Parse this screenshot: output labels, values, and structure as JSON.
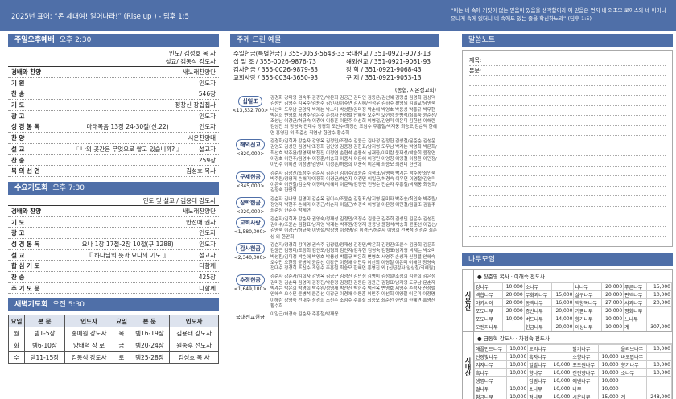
{
  "header": {
    "slogan": "2025년 표어: “온 세대여! 일어나라!” (Rise up ) - 딤후 1:5",
    "verse": "“이는 네 속에 거짓이 없는 믿음이 있음을 생각함이라 이 믿음은 먼저 네 외조모 로이스와 네 어머니 유니게 속에 있더니 네 속에도 있는 줄을 확신하노라” (딤후 1:5)"
  },
  "sunday": {
    "title": "주일오후예배",
    "time": "오후 2:30",
    "lead1": "인도/ 김성호 목 사",
    "lead2": "설교/ 김동석 강도사",
    "rows": [
      {
        "k": "경배와 찬양",
        "c": "",
        "r": "새노래찬양단"
      },
      {
        "k": "기 원",
        "c": "",
        "r": "인도자"
      },
      {
        "k": "찬 송",
        "c": "",
        "r": "546장"
      },
      {
        "k": "기 도",
        "c": "",
        "r": "정창신 장립집사"
      },
      {
        "k": "광 고",
        "c": "",
        "r": "인도자"
      },
      {
        "k": "성 경 봉 독",
        "c": "마태복음 13장 24-30절(신.22)",
        "r": "인도자"
      },
      {
        "k": "찬 양",
        "c": "",
        "r": "시온찬양대"
      },
      {
        "k": "설 교",
        "c": "『 나의 곳간은 무엇으로 쌓고 있습니까? 』",
        "r": "설교자"
      },
      {
        "k": "찬 송",
        "c": "",
        "r": "259장"
      },
      {
        "k": "복 의 선 언",
        "c": "",
        "r": "김성호 목사"
      }
    ]
  },
  "wednesday": {
    "title": "수요기도회",
    "time": "오후 7:30",
    "lead": "인도 및 설교 / 김용태 강도사",
    "rows": [
      {
        "k": "경배와 찬양",
        "c": "",
        "r": "새노래찬양단"
      },
      {
        "k": "기 도",
        "c": "",
        "r": "안선애 권사"
      },
      {
        "k": "광 고",
        "c": "",
        "r": "인도자"
      },
      {
        "k": "성 경 봉 독",
        "c": "요나 1장 17절-2장 10절(구.1288)",
        "r": "인도자"
      },
      {
        "k": "설 교",
        "c": "『 하나님의 뜻과 요나의 기도 』",
        "r": "설교자"
      },
      {
        "k": "합 심 기 도",
        "c": "",
        "r": "다함께"
      },
      {
        "k": "찬 송",
        "c": "",
        "r": "425장"
      },
      {
        "k": "주 기 도 문",
        "c": "",
        "r": "다함께"
      }
    ]
  },
  "dawn": {
    "title": "새벽기도회",
    "time": "오전 5:30",
    "headers": [
      "요일",
      "본 문",
      "인도자",
      "요일",
      "본 문",
      "인도자"
    ],
    "rows": [
      [
        "월",
        "템1-5장",
        "송예원 강도사",
        "목",
        "템16-19장",
        "김용태 강도사"
      ],
      [
        "화",
        "템6-10장",
        "양태혁 장 로",
        "금",
        "템20-24장",
        "원종후 전도사"
      ],
      [
        "수",
        "템11-15장",
        "김동석 강도사",
        "토",
        "템25-28장",
        "김성호 목 사"
      ]
    ]
  },
  "offering": {
    "title": "주께 드린 예물",
    "accounts": [
      [
        "주일헌금(특별헌금) / 355-0053-5643-33",
        "국내선교 / 351-0921-9073-13"
      ],
      [
        "십 일 조 / 355-0026-9876-73",
        "해외선교 / 351-0921-9061-93"
      ],
      [
        "감사헌금 / 355-0026-9879-83",
        "장 학 / 351-0921-9068-43"
      ],
      [
        "교회사랑 / 355-0034-3650-93",
        "구 제 / 351-0921-9053-13"
      ]
    ],
    "bank_note": "(농협, 시온성교회)",
    "items": [
      {
        "label": "십일조",
        "amount": "<13,532,700>",
        "text": "강경화 강미영 권숙주 김경민/박은희 김공근 김다인 김동은/김선혜 김명섭 김명희 김상덕 김성민 김영수 김옥수/김용주 김인자/이주연 김지혜/신정우 김하수 황영임 김필교/남명숙 나선미 도우남 문양자 박계는 박소미 박성환/김미정 박순애 박영호 박용성 박홍규 박우현 박은희 변영호 서영주/김은주 손성자 신정렬 안혜숙 오수민 오현정 윤병석/최홍숙 윤준선/조성남 이강근/허규숙 이경애 이동훈 이민주 이선희 이영철/김영미 이은미 김한선 이해란 김상진 외 장영숙 전대수 정경희 조신수/최정선 조임수 주홍철/박재웅 최승모/김순덕 한혜연 홍영진 외 최준선 최연상 한만수 황수희"
      },
      {
        "label": "해외선교",
        "amount": "<820,000>",
        "text": "강경화/김희자 강순자 강영옥 김정민/조정수 김윤근 김나정 김정헌 김성철/문준순 김성운 김영모 김성민 김영식/조정희 김인영 김종정 김현표/남지영 도우남 박계는 박영희 박은희/최선호 박주완/정영재 박천진 이정연 손현석 손종식 심재한/이미란 윤재성/박승희 윤정연 이강호 이민주/김영수 이정훈/허승희 이종식 이은혜 이정민 이영칭 이영철 이정환 이민정/이민주 이혜선 이정명/김영미 이정훈/허승희 이종식 이은혜 최승모 최선미 한만희"
      },
      {
        "label": "구제헌금",
        "amount": "<345,000>",
        "text": "강순자 김광진/조정수 김순자 김순진 김이수/조윤순 김형표/남명숙 박계는 박주송/최인숙 박주원/정영재 손해미/이정하 이경근/허순자 이경민 이일근/허경숙 이우연 이영철/김영미 이은숙 이인철/김순자 이정태/박혜미 이준택/김정민 전명순 전순자 주홍철/박재웅 최영희/김정숙 한만희"
      },
      {
        "label": "장학헌금",
        "amount": "<220,000>",
        "text": "강순자 김나영 김명미 김순옥 김이수/조윤순 김형표/남지영 문미자 박주송/최인숙 박주원/정영재 박현주 손혜미 이경근/허순자 이일근/허경숙 이영철 이은정 이민철/김필조 김월주 최순상 한준수 박세현"
      },
      {
        "label": "교회사랑",
        "amount": "<1,580,000>",
        "text": "강순자/김희자 강순자 권영숙/정재성 김정민/조정수 김윤근 김주희 김성민 김은수 김성진 김이수/조윤순 김형표/남지영 박계는 박주원/정영재 윤용남 윤형석/박승희 윤준선 이갑선/김영숙 이강근/허규숙 이영철/박상영 이정명/김 이경근/허순자 이영희 전봉석 정경순 최순상 외 한만희"
      },
      {
        "label": "감사헌금",
        "amount": "<2,340,000>",
        "text": "강순자/정경희 강미영 권숙주 김광렬/정재성 김정민/박은희 김정진/조윤수 김공희 김문희 김윤근 김명미/조정희 김인모/김형희 김인자/김우현 김영숙 김형표/남지영 박계는 박소미 박성환/김미정 박순애 박영호 박용성 박홍규 박은희 변영호 서영주 손성자 신정렬 안혜숙 오수민 오현정 윤병석 윤준선 이강근 이경애 이민주 이선희 이영철 이은미 이해란 장영숙 전대수 정경희 조신수 조임수 주홍철 최승모 한혜연 홍영진 외 [신년감사 임상철/최혜원]"
      },
      {
        "label": "추정헌금",
        "amount": "<1,649,100>",
        "text": "강순자 강순자/김희자 강영옥 김공근 김광진 김민정 김명미 김정철/조정희 김윤희 김은정 김미정 김순옥 김영미 김정진/박은정 김정헌 김동은 김윤근 김형표/남지영 도우남 문순자 박계는 박은희 박영희 박주완/정영재 박천진 박현주 백신옥 변영호 서영주 손성자 신정렬 안혜숙 오수민 윤병석 윤준선 이강근 이경애 이동훈 이민주 이선희 이영철 이은미 이정명 이해란 장영숙 전대수 정경희 조신수 조임수 주홍철 최승모 최준선 한만희 한혜연 홍영진 황수희"
      }
    ],
    "domestic_label": "국내선교헌금",
    "domestic_text": "이일근/허경숙 김순자 주홍철/박재웅"
  },
  "memo": {
    "title": "말씀노트",
    "fields": [
      "제목:",
      "본문:"
    ]
  },
  "tree": {
    "title": "나무모임",
    "groups": [
      {
        "side": "시온산",
        "header": "● 장준영 목사 · 이해숙 전도사",
        "rows": [
          [
            "강나무",
            "10,000",
            "소나무",
            "",
            "나나무",
            "20,000",
            "푸른나무",
            "15,000"
          ],
          [
            "백합나무",
            "20,000",
            "무화과나무",
            "15,000",
            "살구나무",
            "20,000",
            "판백나무",
            "10,000"
          ],
          [
            "아카시아",
            "20,000",
            "동백나무",
            "16,000",
            "백향목나무",
            "27,000",
            "사과나무",
            "20,000"
          ],
          [
            "포도나무",
            "20,000",
            "증산나무",
            "20,000",
            "기쁨나무",
            "20,000",
            "평화나무",
            ""
          ],
          [
            "포도나무",
            "10,000",
            "버드나무",
            "14,000",
            "향기나무",
            "10,000",
            "느나무",
            ""
          ],
          [
            "오렌지나무",
            "",
            "헌금나무",
            "20,000",
            "이상나무",
            "10,000",
            "계",
            "307,000"
          ]
        ]
      },
      {
        "side": "시내산",
        "header": "● 금동혁 강도사 · 차정숙 전도사",
        "rows": [
          [
            "애플민트나무",
            "10,000",
            "오리나무",
            "",
            "발기나무",
            "",
            "올리브나무",
            "10,000"
          ],
          [
            "선장빛나무",
            "10,000",
            "흑자나무",
            "",
            "소향나무",
            "10,000",
            "바오밥나무",
            ""
          ],
          [
            "겨자나무",
            "10,000",
            "일발나무",
            "10,000",
            "포도원나무",
            "10,000",
            "향기나무",
            "10,000"
          ],
          [
            "흑나무",
            "10,000",
            "향나무",
            "10,000",
            "전진향나무",
            "10,000",
            "소나무",
            "10,000"
          ],
          [
            "생명나무",
            "",
            "감람나무",
            "10,000",
            "에벤나무",
            "10,000",
            "",
            ""
          ],
          [
            "걸나무",
            "10,000",
            "소나무",
            "10,000",
            "나무",
            "10,000",
            "",
            ""
          ],
          [
            "황금나무",
            "10,000",
            "정나무",
            "10,000",
            "시온나무",
            "15,000",
            "계",
            "248,000"
          ]
        ]
      }
    ]
  }
}
